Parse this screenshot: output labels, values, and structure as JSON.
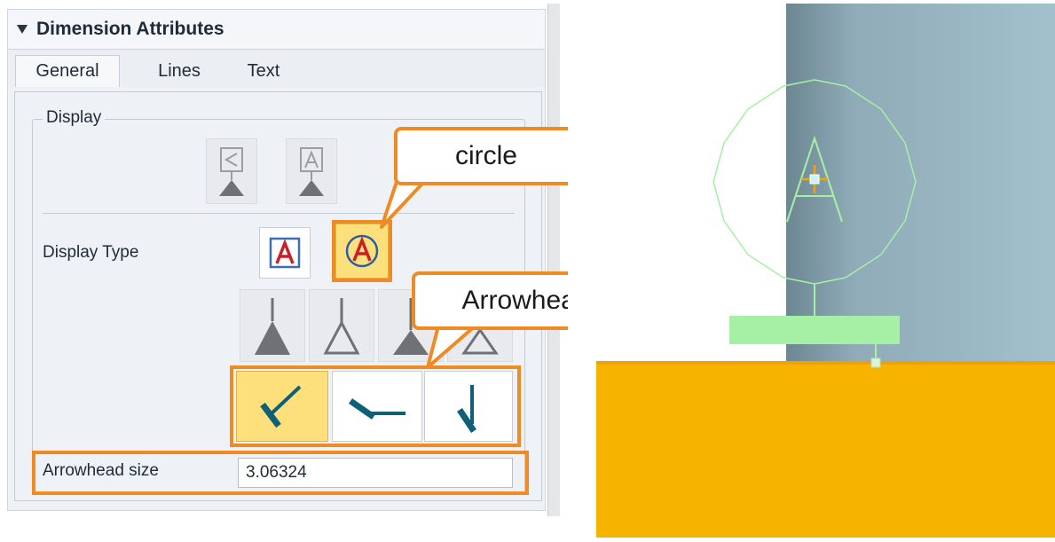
{
  "panel": {
    "title": "Dimension Attributes",
    "tabs": [
      {
        "label": "General",
        "active": true
      },
      {
        "label": "Lines",
        "active": false
      },
      {
        "label": "Text",
        "active": false
      }
    ],
    "display_group": "Display",
    "display_type_label": "Display Type",
    "display_type_options": [
      {
        "icon": "letter-a-square-icon",
        "selected": false
      },
      {
        "icon": "letter-a-circle-icon",
        "selected": true
      }
    ],
    "arrowhead_fill_options": [
      "filled-triangle",
      "open-triangle",
      "filled-triangle-small",
      "open-triangle-small"
    ],
    "arrowhead_style_options": [
      {
        "icon": "check-arrow-icon",
        "selected": true
      },
      {
        "icon": "left-arrow-icon",
        "selected": false
      },
      {
        "icon": "down-arrow-icon",
        "selected": false
      }
    ],
    "arrowhead_size_label": "Arrowhead size",
    "arrowhead_size_value": "3.06324"
  },
  "annotations": {
    "circle_callout": "circle",
    "arrowhead_callout": "Arrowhead"
  },
  "colors": {
    "highlight": "#f08a24",
    "selected_bg": "#fde07c",
    "orange_body": "#f6b400",
    "steel": "#9fbccb",
    "symbol_green": "#a6f0a6",
    "arrow_teal": "#0e5f78",
    "symbol_red": "#c8202a"
  }
}
